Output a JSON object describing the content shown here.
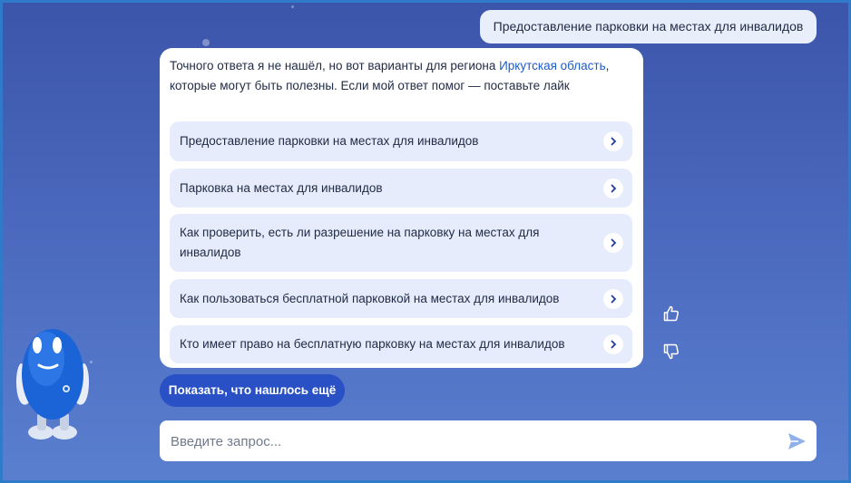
{
  "colors": {
    "background": "#4a68bd",
    "accent": "#2950c5",
    "option_bg": "#e6ecfb",
    "link": "#1f5cc6"
  },
  "user_message": "Предоставление парковки на местах для инвалидов",
  "bot": {
    "intro_before": "Точного ответа я не нашёл, но вот варианты для региона ",
    "region_link": "Иркутская область",
    "intro_after": ", которые могут быть полезны. Если мой ответ помог — поставьте лайк",
    "options": [
      {
        "label": "Предоставление парковки на местах для инвалидов",
        "icon": "chevron-right-icon"
      },
      {
        "label": "Парковка на местах для инвалидов",
        "icon": "chevron-right-icon"
      },
      {
        "label": "Как проверить, есть ли разрешение на парковку на местах для инвалидов",
        "icon": "chevron-right-icon"
      },
      {
        "label": "Как пользоваться бесплатной парковкой на местах для инвалидов",
        "icon": "chevron-right-icon"
      },
      {
        "label": "Кто имеет право на бесплатную парковку на местах для инвалидов",
        "icon": "chevron-right-icon"
      }
    ],
    "feedback": {
      "like_icon": "thumbs-up-icon",
      "dislike_icon": "thumbs-down-icon"
    }
  },
  "show_more_label": "Показать, что нашлось ещё",
  "input": {
    "placeholder": "Введите запрос...",
    "value": "",
    "send_icon": "send-icon"
  },
  "mascot": "robot-assistant"
}
